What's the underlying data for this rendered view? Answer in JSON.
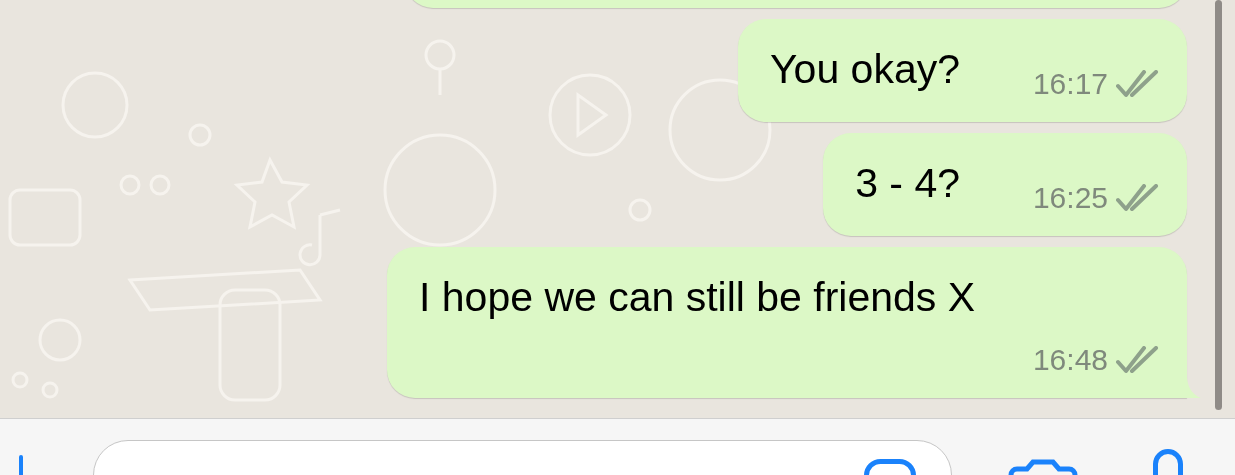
{
  "messages": [
    {
      "text": "You okay?",
      "time": "16:17",
      "read": false,
      "tail": false
    },
    {
      "text": "3 - 4?",
      "time": "16:25",
      "read": false,
      "tail": false
    },
    {
      "text": "I hope we can still be friends X",
      "time": "16:48",
      "read": false,
      "tail": true
    }
  ]
}
